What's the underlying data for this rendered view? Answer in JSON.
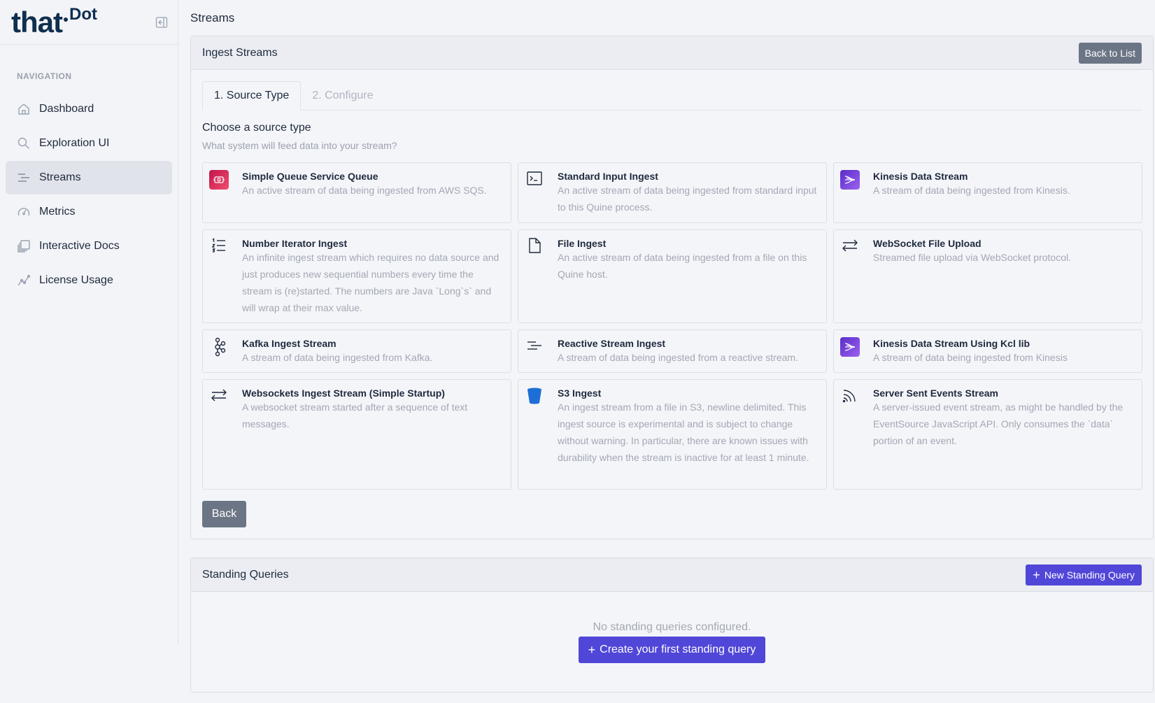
{
  "brand": {
    "logo_main": "that",
    "logo_sup": "Dot"
  },
  "sidebar": {
    "heading": "NAVIGATION",
    "items": [
      {
        "label": "Dashboard",
        "icon": "home-icon"
      },
      {
        "label": "Exploration UI",
        "icon": "search-icon"
      },
      {
        "label": "Streams",
        "icon": "streams-icon",
        "active": true
      },
      {
        "label": "Metrics",
        "icon": "gauge-icon"
      },
      {
        "label": "Interactive Docs",
        "icon": "docs-icon"
      },
      {
        "label": "License Usage",
        "icon": "chart-line-icon"
      }
    ]
  },
  "page": {
    "title": "Streams"
  },
  "ingest": {
    "header": "Ingest Streams",
    "back_to_list": "Back to List",
    "tabs": [
      "1. Source Type",
      "2. Configure"
    ],
    "choose_title": "Choose a source type",
    "choose_sub": "What system will feed data into your stream?",
    "cards": [
      {
        "title": "Simple Queue Service Queue",
        "desc": "An active stream of data being ingested from AWS SQS.",
        "icon": "aws-sqs-icon"
      },
      {
        "title": "Standard Input Ingest",
        "desc": "An active stream of data being ingested from standard input to this Quine process.",
        "icon": "terminal-icon"
      },
      {
        "title": "Kinesis Data Stream",
        "desc": "A stream of data being ingested from Kinesis.",
        "icon": "aws-kinesis-icon"
      },
      {
        "title": "Number Iterator Ingest",
        "desc": "An infinite ingest stream which requires no data source and just produces new sequential numbers every time the stream is (re)started. The numbers are Java `Long`s` and will wrap at their max value.",
        "icon": "numbered-list-icon"
      },
      {
        "title": "File Ingest",
        "desc": "An active stream of data being ingested from a file on this Quine host.",
        "icon": "file-icon"
      },
      {
        "title": "WebSocket File Upload",
        "desc": "Streamed file upload via WebSocket protocol.",
        "icon": "arrows-exchange-icon"
      },
      {
        "title": "Kafka Ingest Stream",
        "desc": "A stream of data being ingested from Kafka.",
        "icon": "kafka-icon"
      },
      {
        "title": "Reactive Stream Ingest",
        "desc": "A stream of data being ingested from a reactive stream.",
        "icon": "align-left-icon"
      },
      {
        "title": "Kinesis Data Stream Using Kcl lib",
        "desc": "A stream of data being ingested from Kinesis",
        "icon": "aws-kinesis-icon"
      },
      {
        "title": "Websockets Ingest Stream (Simple Startup)",
        "desc": "A websocket stream started after a sequence of text messages.",
        "icon": "arrows-exchange-icon"
      },
      {
        "title": "S3 Ingest",
        "desc": "An ingest stream from a file in S3, newline delimited. This ingest source is experimental and is subject to change without warning. In particular, there are known issues with durability when the stream is inactive for at least 1 minute.",
        "icon": "bucket-icon"
      },
      {
        "title": "Server Sent Events Stream",
        "desc": "A server-issued event stream, as might be handled by the EventSource JavaScript API. Only consumes the `data` portion of an event.",
        "icon": "rss-icon"
      }
    ],
    "back": "Back"
  },
  "standing": {
    "header": "Standing Queries",
    "new_button": "New Standing Query",
    "empty": "No standing queries configured.",
    "create_button": "Create your first standing query"
  },
  "colors": {
    "accent": "#5046d8",
    "gray_button": "#6b7585",
    "sqs": "#d21f57",
    "kinesis": "#7c3ce0",
    "s3": "#1d6fd6"
  }
}
